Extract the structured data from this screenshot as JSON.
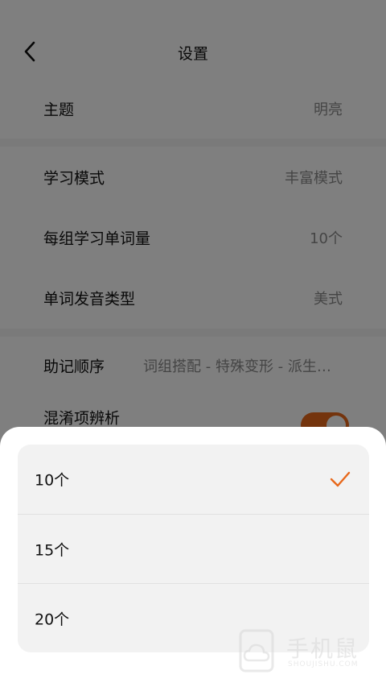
{
  "header": {
    "title": "设置"
  },
  "settings": {
    "theme": {
      "label": "主题",
      "value": "明亮"
    },
    "study_mode": {
      "label": "学习模式",
      "value": "丰富模式"
    },
    "words_per_group": {
      "label": "每组学习单词量",
      "value": "10个"
    },
    "pronunciation": {
      "label": "单词发音类型",
      "value": "美式"
    },
    "mnemonic_order": {
      "label": "助记顺序",
      "value": "词组搭配 - 特殊变形 - 派生…"
    },
    "confusable": {
      "label": "混淆项辨析",
      "enabled": true
    }
  },
  "sheet": {
    "options": [
      {
        "label": "10个",
        "selected": true
      },
      {
        "label": "15个",
        "selected": false
      },
      {
        "label": "20个",
        "selected": false
      }
    ]
  },
  "watermark": {
    "logo_text": "手机鼠",
    "sub_text": "SHOUJISHU.COM"
  },
  "colors": {
    "accent": "#e8681b",
    "overlay": "rgba(0,0,0,0.5)"
  }
}
